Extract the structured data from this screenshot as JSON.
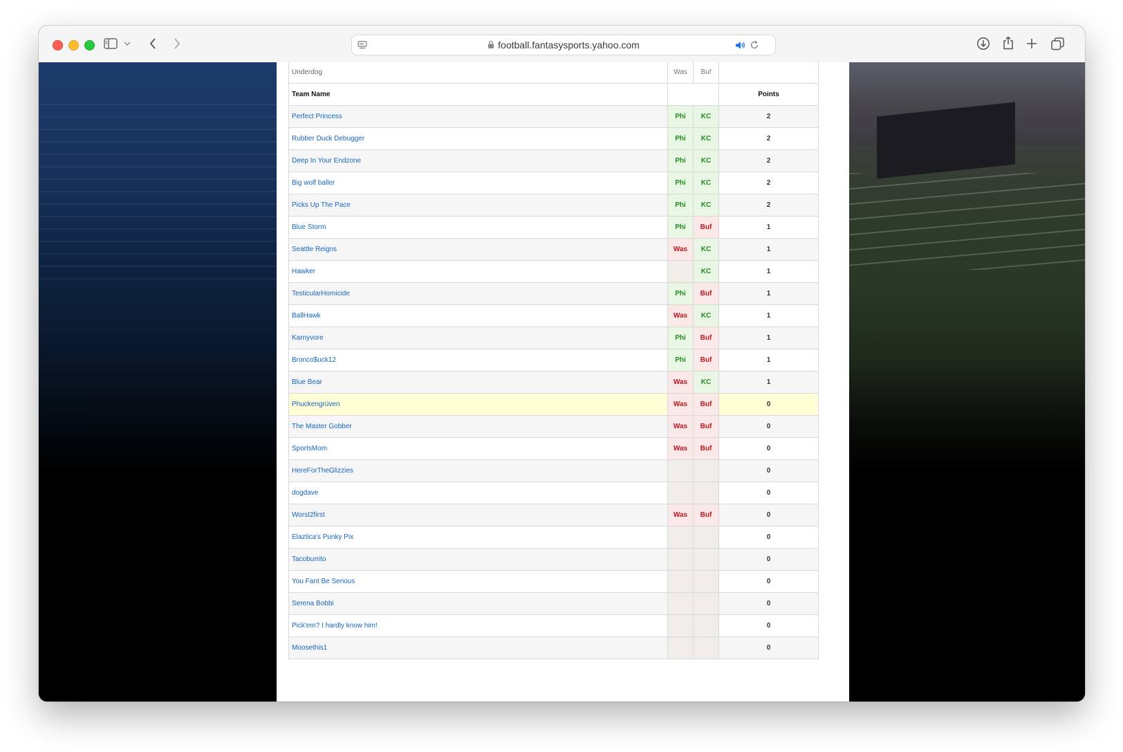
{
  "browser": {
    "url": "football.fantasysports.yahoo.com",
    "icons": [
      "sidebar-icon",
      "chevron-down-icon",
      "back-icon",
      "forward-icon",
      "reader-icon",
      "lock-icon",
      "speaker-icon",
      "reload-icon",
      "download-icon",
      "share-icon",
      "plus-icon",
      "tabs-icon"
    ]
  },
  "table": {
    "subheader": {
      "label": "Underdog",
      "col1": "Was",
      "col2": "Buf"
    },
    "header": {
      "team": "Team Name",
      "points": "Points"
    },
    "rows": [
      {
        "team": "Perfect Princess",
        "pick1": "Phi",
        "pick2": "KC",
        "points": "2"
      },
      {
        "team": "Rubber Duck Debugger",
        "pick1": "Phi",
        "pick2": "KC",
        "points": "2"
      },
      {
        "team": "Deep In Your Endzone",
        "pick1": "Phi",
        "pick2": "KC",
        "points": "2"
      },
      {
        "team": "Big wolf baller",
        "pick1": "Phi",
        "pick2": "KC",
        "points": "2"
      },
      {
        "team": "Picks Up The Pace",
        "pick1": "Phi",
        "pick2": "KC",
        "points": "2"
      },
      {
        "team": "Blue Storm",
        "pick1": "Phi",
        "pick2": "Buf",
        "points": "1"
      },
      {
        "team": "Seattle Reigns",
        "pick1": "Was",
        "pick2": "KC",
        "points": "1"
      },
      {
        "team": "Hawker",
        "pick1": "",
        "pick2": "KC",
        "points": "1"
      },
      {
        "team": "TesticularHomicide",
        "pick1": "Phi",
        "pick2": "Buf",
        "points": "1"
      },
      {
        "team": "BallHawk",
        "pick1": "Was",
        "pick2": "KC",
        "points": "1"
      },
      {
        "team": "Karnyvore",
        "pick1": "Phi",
        "pick2": "Buf",
        "points": "1"
      },
      {
        "team": "Bronco$uck12",
        "pick1": "Phi",
        "pick2": "Buf",
        "points": "1"
      },
      {
        "team": "Blue Bear",
        "pick1": "Was",
        "pick2": "KC",
        "points": "1"
      },
      {
        "team": "Phuckengrüven",
        "pick1": "Was",
        "pick2": "Buf",
        "points": "0",
        "highlight": true
      },
      {
        "team": "The Master Gobber",
        "pick1": "Was",
        "pick2": "Buf",
        "points": "0"
      },
      {
        "team": "SportsMom",
        "pick1": "Was",
        "pick2": "Buf",
        "points": "0"
      },
      {
        "team": "HereForTheGlizzies",
        "pick1": "",
        "pick2": "",
        "points": "0"
      },
      {
        "team": "dogdave",
        "pick1": "",
        "pick2": "",
        "points": "0"
      },
      {
        "team": "Worst2first",
        "pick1": "Was",
        "pick2": "Buf",
        "points": "0"
      },
      {
        "team": "Elaztica's Punky Pix",
        "pick1": "",
        "pick2": "",
        "points": "0"
      },
      {
        "team": "Tacoburrito",
        "pick1": "",
        "pick2": "",
        "points": "0"
      },
      {
        "team": "You Fant Be Serious",
        "pick1": "",
        "pick2": "",
        "points": "0"
      },
      {
        "team": "Serena Bobbi",
        "pick1": "",
        "pick2": "",
        "points": "0"
      },
      {
        "team": "Pick'em? I hardly know him!",
        "pick1": "",
        "pick2": "",
        "points": "0"
      },
      {
        "team": "Moosethis1",
        "pick1": "",
        "pick2": "",
        "points": "0"
      }
    ]
  },
  "colors": {
    "link": "#1565c0",
    "win_text": "#228b22",
    "win_bg": "#eaf6e4",
    "loss_text": "#c0151b",
    "loss_bg": "#fbe9e9",
    "empty_bg": "#f1eee9",
    "highlight_bg": "#fffed5"
  }
}
